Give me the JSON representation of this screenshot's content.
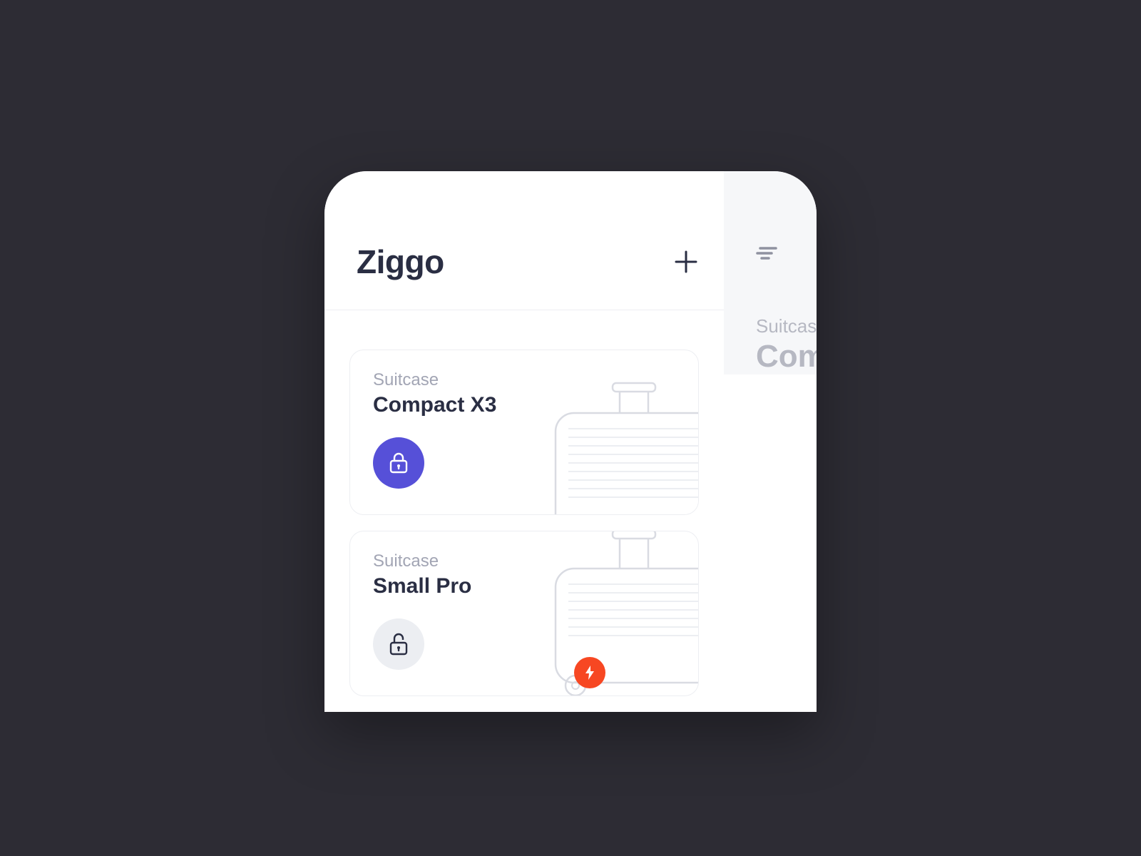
{
  "header": {
    "title": "Ziggo"
  },
  "cards": [
    {
      "category": "Suitcase",
      "name": "Compact X3",
      "locked": true,
      "alert": false
    },
    {
      "category": "Suitcase",
      "name": "Small Pro",
      "locked": false,
      "alert": true
    }
  ],
  "detail": {
    "category": "Suitcase",
    "name": "Com"
  },
  "colors": {
    "accent": "#5650d8",
    "alert": "#f74722",
    "text_primary": "#2a2e43",
    "text_muted": "#a2a5b4",
    "background": "#2d2c34"
  }
}
